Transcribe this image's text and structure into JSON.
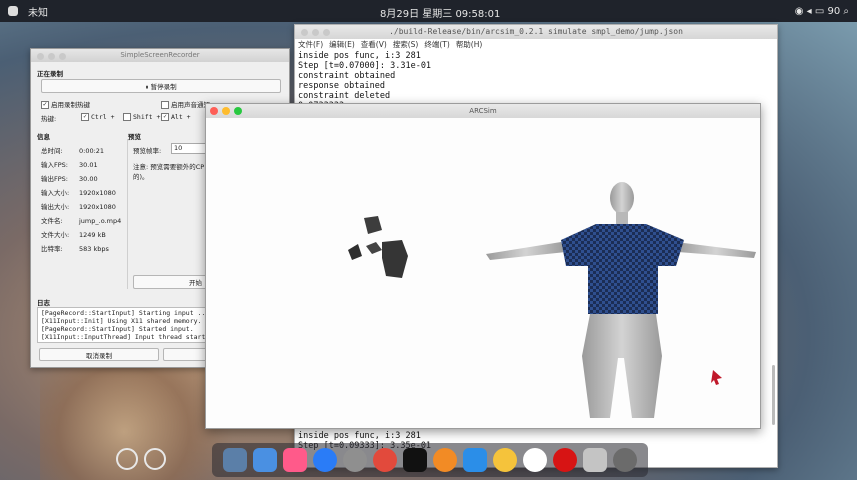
{
  "menubar": {
    "app_name": "未知",
    "clock": "8月29日 星期三 09:58:01",
    "tray": "◉ ◂ ▭ 90 ⌕"
  },
  "terminal": {
    "title": "./build-Release/bin/arcsim_0.2.1 simulate smpl_demo/jump.json",
    "menu": [
      "文件(F)",
      "编辑(E)",
      "查看(V)",
      "搜索(S)",
      "终端(T)",
      "帮助(H)"
    ],
    "lines": [
      "inside pos func, i:3 281",
      "Step [t=0.07000]: 3.31e-01",
      "constraint obtained",
      "response obtained",
      "constraint deleted",
      "0.0733333"
    ],
    "bottom_lines": [
      "inside pos func, i:3 281",
      "Step [t=0.09333]: 3.35e-01"
    ]
  },
  "ssr": {
    "title": "SimpleScreenRecorder",
    "recording_label": "正在录制",
    "pause_button": "⏸ 暂停录制",
    "enable_hotkey": "启用录制热键",
    "enable_sound": "启用声音通知",
    "hotkey_label": "热键:",
    "ctrl": "Ctrl +",
    "shift": "Shift +",
    "alt": "Alt +",
    "info_label": "信息",
    "preview_label": "预览",
    "info": [
      {
        "k": "总时间:",
        "v": "0:00:21"
      },
      {
        "k": "输入FPS:",
        "v": "30.01"
      },
      {
        "k": "输出FPS:",
        "v": "30.00"
      },
      {
        "k": "输入大小:",
        "v": "1920x1080"
      },
      {
        "k": "输出大小:",
        "v": "1920x1080"
      },
      {
        "k": "文件名:",
        "v": "jump_.o.mp4"
      },
      {
        "k": "文件大小:",
        "v": "1249 kB"
      },
      {
        "k": "比特率:",
        "v": "583 kbps"
      }
    ],
    "preview_rate_label": "预览帧率:",
    "preview_rate_value": "10",
    "note": "注意: 预览需要额外的CP",
    "note2": "的)。",
    "start_button": "开始",
    "log_label": "日志",
    "log": [
      "[PageRecord::StartInput] Starting input ...",
      "[X11Input::Init] Using X11 shared memory.",
      "[PageRecord::StartInput] Started input.",
      "[X11Input::InputThread] Input thread started."
    ],
    "cancel_button": "取消录制"
  },
  "arcsim": {
    "title": "ARCSim"
  },
  "colors": {
    "close": "#fe5f57",
    "min": "#febc2e",
    "max": "#28c840",
    "shirt": "#2f4f8f",
    "shirt_check": "#1b2d55",
    "body": "#bcbcbc",
    "cursor": "#c0182a"
  },
  "dock": [
    "preview-icon",
    "finder-icon",
    "music-icon",
    "appstore-icon",
    "settings-icon",
    "netease-icon",
    "terminal-icon",
    "firefox-icon",
    "vscode-icon",
    "chrome-icon",
    "typora-icon",
    "record-icon",
    "display-icon",
    "launchpad-icon"
  ]
}
